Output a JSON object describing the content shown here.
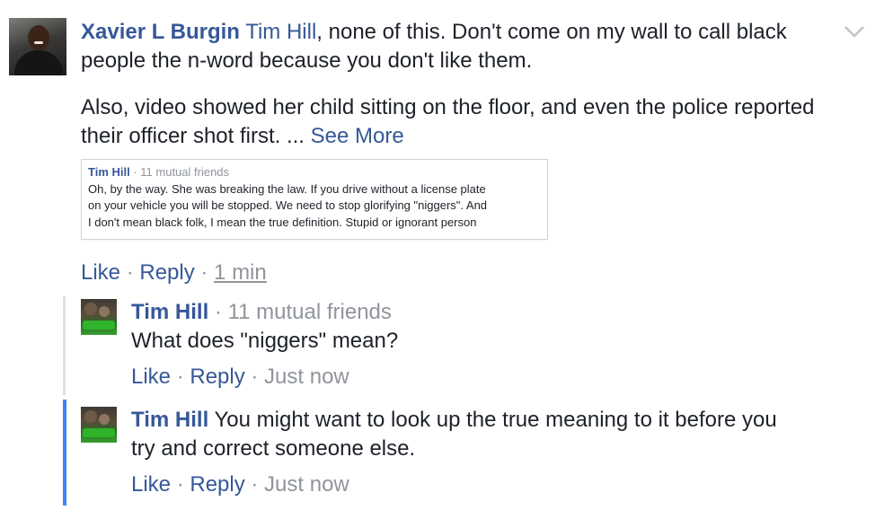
{
  "comment": {
    "author": "Xavier L Burgin",
    "mention": "Tim Hill",
    "text_line1_rest": ", none of this. Don't come on my wall to call black",
    "text_line2": "people the n-word because you don't like them.",
    "para2_line1": "Also, video showed her child sitting on the floor, and even the police reported",
    "para2_line2": "their officer shot first. ...",
    "see_more": "See More",
    "quote": {
      "name": "Tim Hill",
      "meta": " · 11 mutual friends",
      "line1": "Oh, by the way. She was breaking the law. If you drive without a license plate",
      "line2": "on your vehicle you will be stopped. We need to stop glorifying \"niggers\". And",
      "line3": "I don't mean black folk, I mean the true definition. Stupid or ignorant person"
    },
    "actions": {
      "like": "Like",
      "reply": "Reply",
      "time": "1 min",
      "sep": " · "
    }
  },
  "replies": [
    {
      "author": "Tim Hill",
      "meta": "· 11 mutual friends",
      "text": "What does \"niggers\" mean?",
      "like": "Like",
      "reply": "Reply",
      "time": "Just now"
    },
    {
      "author": "Tim Hill",
      "text_line1": "You might want to look up the true meaning to it before you",
      "text_line2": "try and correct someone else.",
      "like": "Like",
      "reply": "Reply",
      "time": "Just now"
    }
  ],
  "icons": {
    "options": "chevron-down-icon"
  },
  "colors": {
    "link": "#365899",
    "meta": "#90949c",
    "thread_active": "#4080ff"
  }
}
